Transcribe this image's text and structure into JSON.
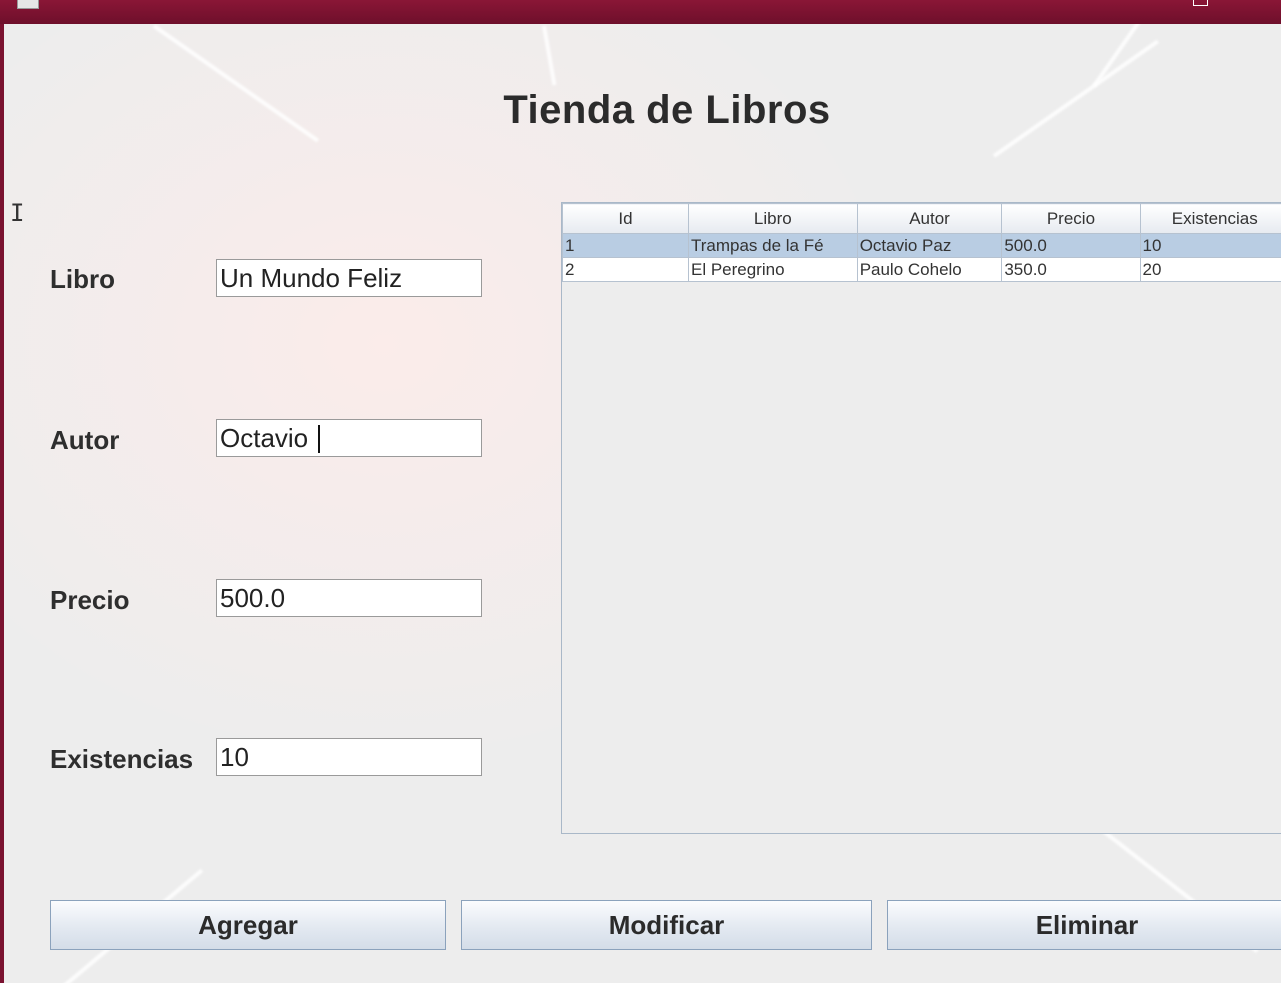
{
  "window": {
    "icon": "app-window-icon",
    "restore_icon": "restore-icon"
  },
  "title": "Tienda de Libros",
  "form": {
    "libro_label": "Libro",
    "libro_value": "Un Mundo Feliz",
    "autor_label": "Autor",
    "autor_value": "Octavio ",
    "precio_label": "Precio",
    "precio_value": "500.0",
    "existencias_label": "Existencias",
    "existencias_value": "10"
  },
  "table": {
    "headers": [
      "Id",
      "Libro",
      "Autor",
      "Precio",
      "Existencias"
    ],
    "rows": [
      {
        "selected": true,
        "cells": [
          "1",
          "Trampas de la Fé",
          "Octavio Paz",
          "500.0",
          "10"
        ]
      },
      {
        "selected": false,
        "cells": [
          "2",
          "El Peregrino",
          "Paulo Cohelo",
          "350.0",
          "20"
        ]
      }
    ]
  },
  "buttons": {
    "agregar": "Agregar",
    "modificar": "Modificar",
    "eliminar": "Eliminar"
  },
  "colors": {
    "titlebar": "#7a1230",
    "selected_row": "#b9cde3"
  }
}
